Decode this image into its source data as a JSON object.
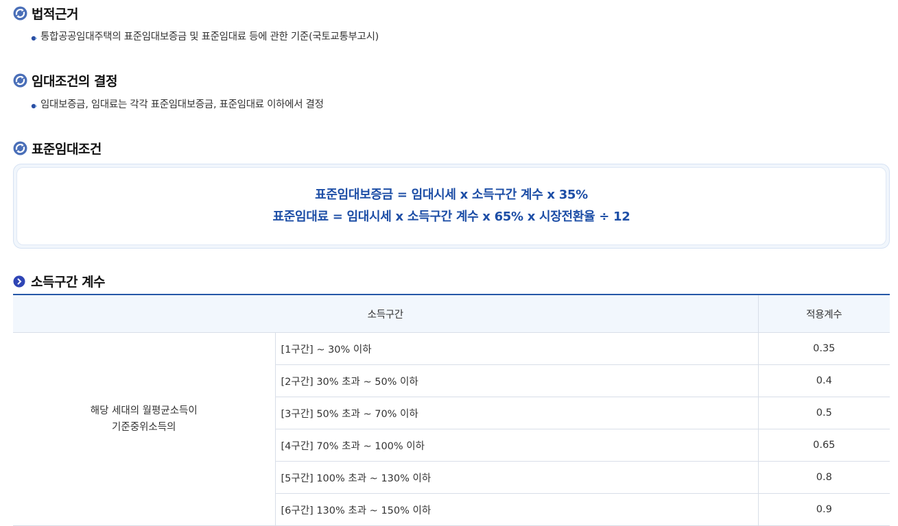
{
  "sections": [
    {
      "title": "법적근거",
      "bullets": [
        "통합공공임대주택의 표준임대보증금 및 표준임대료 등에 관한 기준(국토교통부고시)"
      ]
    },
    {
      "title": "임대조건의 결정",
      "bullets": [
        "임대보증금, 임대료는 각각 표준임대보증금, 표준임대료 이하에서 결정"
      ]
    },
    {
      "title": "표준임대조건",
      "bullets": []
    }
  ],
  "formulas": [
    "표준임대보증금 = 임대시세 x 소득구간 계수 x 35%",
    "표준임대료 = 임대시세 x 소득구간 계수 x 65% x 시장전환율 ÷ 12"
  ],
  "income_table": {
    "title": "소득구간 계수",
    "headers": {
      "income": "소득구간",
      "coef": "적용계수"
    },
    "group_label": [
      "해당 세대의 월평균소득이",
      "기준중위소득의"
    ],
    "rows": [
      {
        "range": "[1구간] ~ 30% 이하",
        "coef": "0.35"
      },
      {
        "range": "[2구간] 30% 초과 ~ 50% 이하",
        "coef": "0.4"
      },
      {
        "range": "[3구간] 50% 초과 ~ 70% 이하",
        "coef": "0.5"
      },
      {
        "range": "[4구간] 70% 초과 ~ 100% 이하",
        "coef": "0.65"
      },
      {
        "range": "[5구간] 100% 초과 ~ 130% 이하",
        "coef": "0.8"
      },
      {
        "range": "[6구간] 130% 초과 ~ 150% 이하",
        "coef": "0.9"
      }
    ]
  },
  "colors": {
    "accent": "#2557a7",
    "formula_text": "#1d4ea6",
    "header_bg": "#f2f7fd"
  },
  "icons": {
    "section": "arrows-cycle-icon",
    "subsection": "chevron-right-circle-icon",
    "bullet": "dot-bullet-icon"
  }
}
